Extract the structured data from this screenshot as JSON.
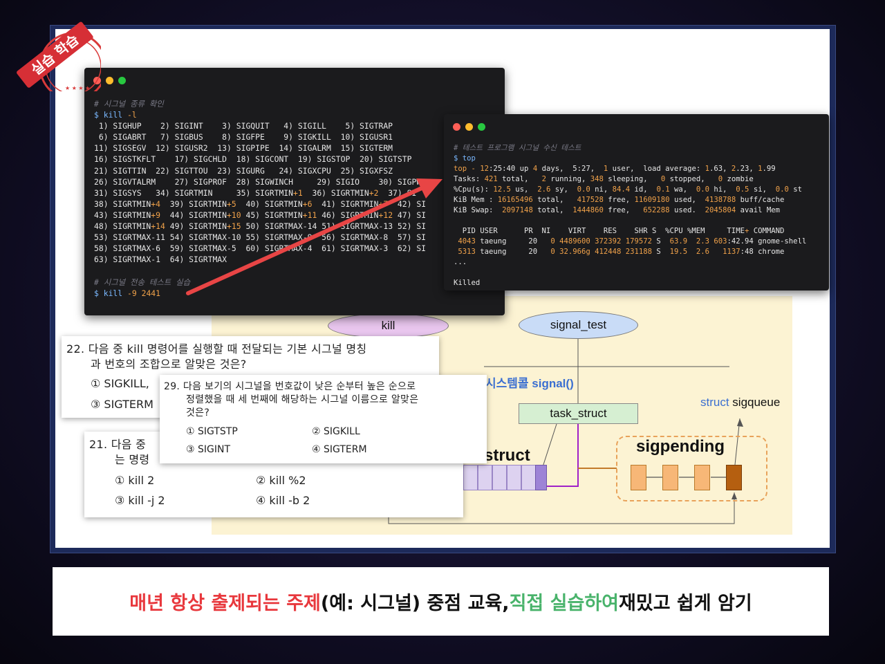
{
  "stamp": {
    "text": "실습 학습"
  },
  "terminal_left": {
    "lines": [
      {
        "parts": [
          {
            "c": "cmt",
            "t": "# 시그널 종류 확인"
          }
        ]
      },
      {
        "parts": [
          {
            "c": "prompt",
            "t": "$ kill "
          },
          {
            "c": "hi",
            "t": "-l"
          }
        ]
      },
      {
        "parts": [
          {
            "c": "wh",
            "t": " 1) SIGHUP    2) SIGINT    3) SIGQUIT   4) SIGILL    5) SIGTRAP"
          }
        ]
      },
      {
        "parts": [
          {
            "c": "wh",
            "t": " 6) SIGABRT   7) SIGBUS    8) SIGFPE    9) SIGKILL  10) SIGUSR1"
          }
        ]
      },
      {
        "parts": [
          {
            "c": "wh",
            "t": "11) SIGSEGV  12) SIGUSR2  13) SIGPIPE  14) SIGALRM  15) SIGTERM"
          }
        ]
      },
      {
        "parts": [
          {
            "c": "wh",
            "t": "16) SIGSTKFLT    17) SIGCHLD  18) SIGCONT  19) SIGSTOP  20) SIGTSTP"
          }
        ]
      },
      {
        "parts": [
          {
            "c": "wh",
            "t": "21) SIGTTIN  22) SIGTTOU  23) SIGURG   24) SIGXCPU  25) SIGXFSZ"
          }
        ]
      },
      {
        "parts": [
          {
            "c": "wh",
            "t": "26) SIGVTALRM    27) SIGPROF  28) SIGWINCH     29) SIGIO    30) SIGPWR"
          }
        ]
      },
      {
        "parts": [
          {
            "c": "wh",
            "t": "31) SIGSYS   34) SIGRTMIN     35) SIGRTMIN"
          },
          {
            "c": "hi",
            "t": "+1"
          },
          {
            "c": "wh",
            "t": "  36) SIGRTMIN"
          },
          {
            "c": "hi",
            "t": "+2"
          },
          {
            "c": "wh",
            "t": "  37) SI"
          }
        ]
      },
      {
        "parts": [
          {
            "c": "wh",
            "t": "38) SIGRTMIN"
          },
          {
            "c": "hi",
            "t": "+4"
          },
          {
            "c": "wh",
            "t": "  39) SIGRTMIN"
          },
          {
            "c": "hi",
            "t": "+5"
          },
          {
            "c": "wh",
            "t": "  40) SIGRTMIN"
          },
          {
            "c": "hi",
            "t": "+6"
          },
          {
            "c": "wh",
            "t": "  41) SIGRTMIN"
          },
          {
            "c": "hi",
            "t": "+7"
          },
          {
            "c": "wh",
            "t": "  42) SI"
          }
        ]
      },
      {
        "parts": [
          {
            "c": "wh",
            "t": "43) SIGRTMIN"
          },
          {
            "c": "hi",
            "t": "+9"
          },
          {
            "c": "wh",
            "t": "  44) SIGRTMIN"
          },
          {
            "c": "hi",
            "t": "+10"
          },
          {
            "c": "wh",
            "t": " 45) SIGRTMIN"
          },
          {
            "c": "hi",
            "t": "+11"
          },
          {
            "c": "wh",
            "t": " 46) SIGRTMIN"
          },
          {
            "c": "hi",
            "t": "+12"
          },
          {
            "c": "wh",
            "t": " 47) SI"
          }
        ]
      },
      {
        "parts": [
          {
            "c": "wh",
            "t": "48) SIGRTMIN"
          },
          {
            "c": "hi",
            "t": "+14"
          },
          {
            "c": "wh",
            "t": " 49) SIGRTMIN"
          },
          {
            "c": "hi",
            "t": "+15"
          },
          {
            "c": "wh",
            "t": " 50) SIGRTMAX-14 51) SIGRTMAX-13 52) SI"
          }
        ]
      },
      {
        "parts": [
          {
            "c": "wh",
            "t": "53) SIGRTMAX-11 54) SIGRTMAX-10 55) SIGRTMAX-9  56) SIGRTMAX-8  57) SI"
          }
        ]
      },
      {
        "parts": [
          {
            "c": "wh",
            "t": "58) SIGRTMAX-6  59) SIGRTMAX-5  60) SIGRTMAX-4  61) SIGRTMAX-3  62) SI"
          }
        ]
      },
      {
        "parts": [
          {
            "c": "wh",
            "t": "63) SIGRTMAX-1  64) SIGRTMAX"
          }
        ]
      },
      {
        "parts": [
          {
            "c": "wh",
            "t": " "
          }
        ]
      },
      {
        "parts": [
          {
            "c": "cmt",
            "t": "# 시그널 전송 테스트 실습"
          }
        ]
      },
      {
        "parts": [
          {
            "c": "prompt",
            "t": "$ kill "
          },
          {
            "c": "hi",
            "t": "-9 2441"
          }
        ]
      }
    ]
  },
  "terminal_right": {
    "lines": [
      {
        "parts": [
          {
            "c": "cmt",
            "t": "# 테스트 프로그램 시그널 수신 테스트"
          }
        ]
      },
      {
        "parts": [
          {
            "c": "prompt",
            "t": "$ top"
          }
        ]
      },
      {
        "parts": [
          {
            "c": "hi",
            "t": "top - 12"
          },
          {
            "c": "wh",
            "t": ":25:40 up "
          },
          {
            "c": "hi",
            "t": "4"
          },
          {
            "c": "wh",
            "t": " days,  5:27,  "
          },
          {
            "c": "hi",
            "t": "1"
          },
          {
            "c": "wh",
            "t": " user,  load average: "
          },
          {
            "c": "hi",
            "t": "1"
          },
          {
            "c": "wh",
            "t": ".63, "
          },
          {
            "c": "hi",
            "t": "2"
          },
          {
            "c": "wh",
            "t": ".23, "
          },
          {
            "c": "hi",
            "t": "1"
          },
          {
            "c": "wh",
            "t": ".99"
          }
        ]
      },
      {
        "parts": [
          {
            "c": "wh",
            "t": "Tasks: "
          },
          {
            "c": "hi",
            "t": "421"
          },
          {
            "c": "wh",
            "t": " total,   "
          },
          {
            "c": "hi",
            "t": "2"
          },
          {
            "c": "wh",
            "t": " running, "
          },
          {
            "c": "hi",
            "t": "348"
          },
          {
            "c": "wh",
            "t": " sleeping,   "
          },
          {
            "c": "hi",
            "t": "0"
          },
          {
            "c": "wh",
            "t": " stopped,   "
          },
          {
            "c": "hi",
            "t": "0"
          },
          {
            "c": "wh",
            "t": " zombie"
          }
        ]
      },
      {
        "parts": [
          {
            "c": "wh",
            "t": "%Cpu(s): "
          },
          {
            "c": "hi",
            "t": "12.5"
          },
          {
            "c": "wh",
            "t": " us,  "
          },
          {
            "c": "hi",
            "t": "2.6"
          },
          {
            "c": "wh",
            "t": " sy,  "
          },
          {
            "c": "hi",
            "t": "0.0"
          },
          {
            "c": "wh",
            "t": " ni, "
          },
          {
            "c": "hi",
            "t": "84.4"
          },
          {
            "c": "wh",
            "t": " id,  "
          },
          {
            "c": "hi",
            "t": "0.1"
          },
          {
            "c": "wh",
            "t": " wa,  "
          },
          {
            "c": "hi",
            "t": "0.0"
          },
          {
            "c": "wh",
            "t": " hi,  "
          },
          {
            "c": "hi",
            "t": "0.5"
          },
          {
            "c": "wh",
            "t": " si,  "
          },
          {
            "c": "hi",
            "t": "0.0"
          },
          {
            "c": "wh",
            "t": " st"
          }
        ]
      },
      {
        "parts": [
          {
            "c": "wh",
            "t": "KiB Mem : "
          },
          {
            "c": "hi",
            "t": "16165496"
          },
          {
            "c": "wh",
            "t": " total,   "
          },
          {
            "c": "hi",
            "t": "417528"
          },
          {
            "c": "wh",
            "t": " free, "
          },
          {
            "c": "hi",
            "t": "11609180"
          },
          {
            "c": "wh",
            "t": " used,  "
          },
          {
            "c": "hi",
            "t": "4138788"
          },
          {
            "c": "wh",
            "t": " buff/cache"
          }
        ]
      },
      {
        "parts": [
          {
            "c": "wh",
            "t": "KiB Swap:  "
          },
          {
            "c": "hi",
            "t": "2097148"
          },
          {
            "c": "wh",
            "t": " total,  "
          },
          {
            "c": "hi",
            "t": "1444860"
          },
          {
            "c": "wh",
            "t": " free,   "
          },
          {
            "c": "hi",
            "t": "652288"
          },
          {
            "c": "wh",
            "t": " used.  "
          },
          {
            "c": "hi",
            "t": "2045804"
          },
          {
            "c": "wh",
            "t": " avail Mem"
          }
        ]
      },
      {
        "parts": [
          {
            "c": "wh",
            "t": " "
          }
        ]
      },
      {
        "parts": [
          {
            "c": "wh",
            "t": "  PID USER      PR  NI    VIRT    RES    SHR S  %CPU %MEM     TIME"
          },
          {
            "c": "hi",
            "t": "+"
          },
          {
            "c": "wh",
            "t": " COMMAND"
          }
        ]
      },
      {
        "parts": [
          {
            "c": "hi",
            "t": " 4043"
          },
          {
            "c": "wh",
            "t": " taeung     20   "
          },
          {
            "c": "hi",
            "t": "0"
          },
          {
            "c": "wh",
            "t": " "
          },
          {
            "c": "hi",
            "t": "4489600 372392 179572"
          },
          {
            "c": "wh",
            "t": " S  "
          },
          {
            "c": "hi",
            "t": "63.9"
          },
          {
            "c": "wh",
            "t": "  "
          },
          {
            "c": "hi",
            "t": "2.3"
          },
          {
            "c": "wh",
            "t": " "
          },
          {
            "c": "hi",
            "t": "603"
          },
          {
            "c": "wh",
            "t": ":42.94 gnome-shell"
          }
        ]
      },
      {
        "parts": [
          {
            "c": "hi",
            "t": " 5313"
          },
          {
            "c": "wh",
            "t": " taeung     20   "
          },
          {
            "c": "hi",
            "t": "0"
          },
          {
            "c": "wh",
            "t": " "
          },
          {
            "c": "hi",
            "t": "32.966g 412448 231188"
          },
          {
            "c": "wh",
            "t": " S  "
          },
          {
            "c": "hi",
            "t": "19.5"
          },
          {
            "c": "wh",
            "t": "  "
          },
          {
            "c": "hi",
            "t": "2.6"
          },
          {
            "c": "wh",
            "t": "   "
          },
          {
            "c": "hi",
            "t": "1137"
          },
          {
            "c": "wh",
            "t": ":48 chrome"
          }
        ]
      },
      {
        "parts": [
          {
            "c": "wh",
            "t": "..."
          }
        ]
      },
      {
        "parts": [
          {
            "c": "wh",
            "t": " "
          }
        ]
      },
      {
        "parts": [
          {
            "c": "wh",
            "t": "Killed"
          }
        ]
      }
    ]
  },
  "diagram": {
    "kill_label": "kill",
    "signal_test_label": "signal_test",
    "syscall_label": "시스템콜 signal()",
    "task_struct_label": "task_struct",
    "sigqueue_kw": "struct",
    "sigqueue_name": " sigqueue",
    "sigpending_label": "sigpending",
    "struct_label": "struct"
  },
  "q22": {
    "line1": "22. 다음 중 kill 명령어를 실행할 때 전달되는 기본 시그널 명칭",
    "line2": "과 번호의 조합으로 알맞은 것은?",
    "opt1": "① SIGKILL,",
    "opt3": "③ SIGTERM"
  },
  "q21": {
    "line1": "21. 다음 중",
    "line2": "는 명령",
    "opt1": "① kill 2",
    "opt2": "② kill %2",
    "opt3": "③ kill -j 2",
    "opt4": "④ kill -b 2"
  },
  "q29": {
    "line1": "29. 다음 보기의 시그널을 번호값이 낮은 순부터 높은 순으로",
    "line2": "정렬했을 때 세 번째에 해당하는 시그널 이름으로 알맞은",
    "line3": "것은?",
    "opt1": "① SIGTSTP",
    "opt2": "② SIGKILL",
    "opt3": "③ SIGINT",
    "opt4": "④ SIGTERM"
  },
  "caption": {
    "red": "매년 항상 출제되는 주제",
    "black1": "(예: 시그널) 중점 교육, ",
    "green": "직접 실습하여",
    "black2": " 재밌고 쉽게 암기"
  },
  "colors": {
    "accent_red": "#e8383d",
    "accent_green": "#49b36b",
    "terminal_bg": "#1b1b1d",
    "diagram_bg": "#fcf3d3"
  }
}
